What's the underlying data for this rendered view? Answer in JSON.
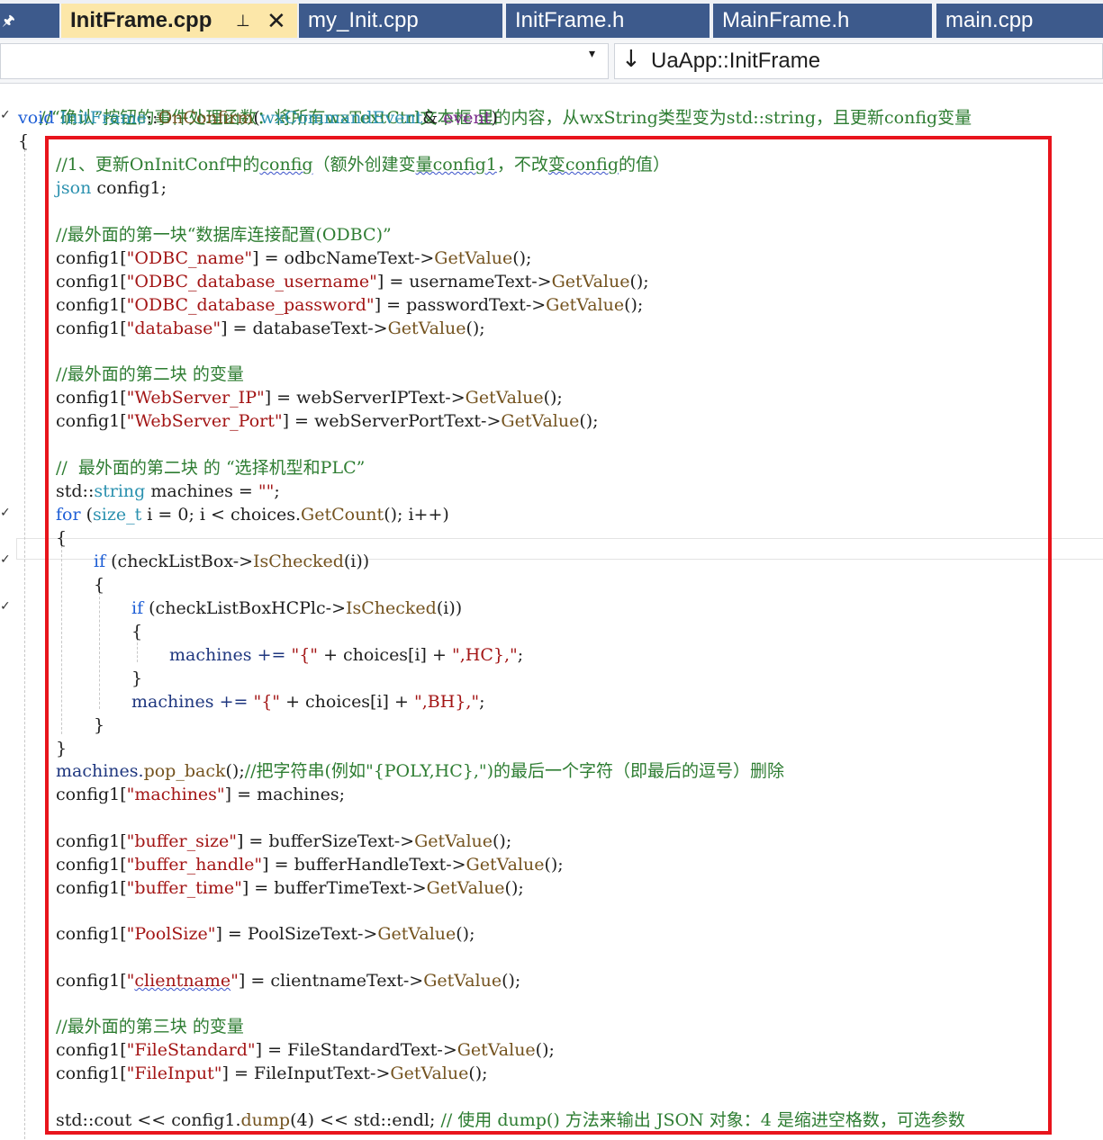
{
  "tabs": [
    {
      "label": "InitFrame.cpp",
      "active": true
    },
    {
      "label": "my_Init.cpp"
    },
    {
      "label": "InitFrame.h"
    },
    {
      "label": "MainFrame.h"
    },
    {
      "label": "main.cpp"
    }
  ],
  "nav": {
    "arrow": "↓",
    "function": "UaApp::InitFrame",
    "dropdown": "▾"
  },
  "icons": {
    "pin": "pin-icon",
    "close": "close-icon",
    "dropdown": "chevron-down-icon",
    "arrow": "arrow-down-icon"
  },
  "colors": {
    "highlight_box": "#e8141c",
    "active_tab": "#fce7a9",
    "tab": "#3d5a8c"
  },
  "code": {
    "l0_comment": "//“确认”按钮的事件处理函数：将所有wxTextCtrl文本框 里的内容，从wxString类型变为std::string，且更新config变量",
    "l1_void": "void",
    "l1_class": "InitFrame",
    "l1_sep": "::",
    "l1_fn": "OnConfirm",
    "l1_open": "(",
    "l1_type": "wxCommandEvent",
    "l1_amp": "&",
    "l1_param": " event",
    "l1_close": ")",
    "l2": "{",
    "c1_a": "//1、更新OnInitConf中的",
    "c1_b": "config",
    "c1_c": "（额外创建变",
    "c1_d": "量config1",
    "c1_e": "，不改",
    "c1_f": "变config",
    "c1_g": "的值）",
    "json_kw": "json",
    "json_var": " config1;",
    "c2": "//最外面的第一块“数据库连接配置(ODBC)”",
    "a1_lhs": "config1[",
    "a1_key": "\"ODBC_name\"",
    "a1_mid": "] = odbcNameText->",
    "a1_fn": "GetValue",
    "a1_end": "();",
    "a2_lhs": "config1[",
    "a2_key": "\"ODBC_database_username\"",
    "a2_mid": "] = usernameText->",
    "a2_fn": "GetValue",
    "a2_end": "();",
    "a3_lhs": "config1[",
    "a3_key": "\"ODBC_database_password\"",
    "a3_mid": "] = passwordText->",
    "a3_fn": "GetValue",
    "a3_end": "();",
    "a4_lhs": "config1[",
    "a4_key": "\"database\"",
    "a4_mid": "] = databaseText->",
    "a4_fn": "GetValue",
    "a4_end": "();",
    "c3": "//最外面的第二块 的变量",
    "b1_lhs": "config1[",
    "b1_key": "\"WebServer_IP\"",
    "b1_mid": "] = webServerIPText->",
    "b1_fn": "GetValue",
    "b1_end": "();",
    "b2_lhs": "config1[",
    "b2_key": "\"WebServer_Port\"",
    "b2_mid": "] = webServerPortText->",
    "b2_fn": "GetValue",
    "b2_end": "();",
    "c4": "//  最外面的第二块 的 “选择机型和PLC”",
    "s1_a": "std::",
    "s1_b": "string",
    "s1_c": " machines = ",
    "s1_d": "\"\"",
    "s1_e": ";",
    "for_kw": "for",
    "for_a": " (",
    "for_t": "size_t",
    "for_b": " i = 0; i < choices.",
    "for_fn": "GetCount",
    "for_c": "(); i++)",
    "br_open": "{",
    "br_close": "}",
    "if_kw": "if",
    "if1_a": " (checkListBox->",
    "if1_fn": "IsChecked",
    "if1_b": "(i))",
    "if2_a": " (checkListBoxHCPlc->",
    "if2_fn": "IsChecked",
    "if2_b": "(i))",
    "m1_a": "machines += ",
    "m1_s1": "\"{\"",
    "m1_b": " + choices[i] + ",
    "m1_s2": "\",HC},\"",
    "m1_c": ";",
    "m2_a": "machines += ",
    "m2_s1": "\"{\"",
    "m2_b": " + choices[i] + ",
    "m2_s2": "\",BH},\"",
    "m2_c": ";",
    "pop_a": "machines.",
    "pop_fn": "pop_back",
    "pop_b": "();",
    "pop_c": "//把字符串(例如\"{POLY,HC},\")的最后一个字符（即最后的逗号）删除",
    "cm_lhs": "config1[",
    "cm_key": "\"machines\"",
    "cm_rest": "] = machines;",
    "d1_lhs": "config1[",
    "d1_key": "\"buffer_size\"",
    "d1_mid": "] = bufferSizeText->",
    "d1_fn": "GetValue",
    "d1_end": "();",
    "d2_lhs": "config1[",
    "d2_key": "\"buffer_handle\"",
    "d2_mid": "] = bufferHandleText->",
    "d2_fn": "GetValue",
    "d2_end": "();",
    "d3_lhs": "config1[",
    "d3_key": "\"buffer_time\"",
    "d3_mid": "] = bufferTimeText->",
    "d3_fn": "GetValue",
    "d3_end": "();",
    "e1_lhs": "config1[",
    "e1_key": "\"PoolSize\"",
    "e1_mid": "] = PoolSizeText->",
    "e1_fn": "GetValue",
    "e1_end": "();",
    "f1_lhs": "config1[",
    "f1_q1": "\"",
    "f1_key": "clientname",
    "f1_q2": "\"",
    "f1_mid": "] = clientnameText->",
    "f1_fn": "GetValue",
    "f1_end": "();",
    "c5": "//最外面的第三块 的变量",
    "g1_lhs": "config1[",
    "g1_key": "\"FileStandard\"",
    "g1_mid": "] = FileStandardText->",
    "g1_fn": "GetValue",
    "g1_end": "();",
    "g2_lhs": "config1[",
    "g2_key": "\"FileInput\"",
    "g2_mid": "] = FileInputText->",
    "g2_fn": "GetValue",
    "g2_end": "();",
    "o_a": "std::cout << config1.",
    "o_fn": "dump",
    "o_b": "(4) << std::endl; ",
    "o_c": "// 使用 dump() 方法来输出 JSON 对象：4 是缩进空格数，可选参数"
  }
}
